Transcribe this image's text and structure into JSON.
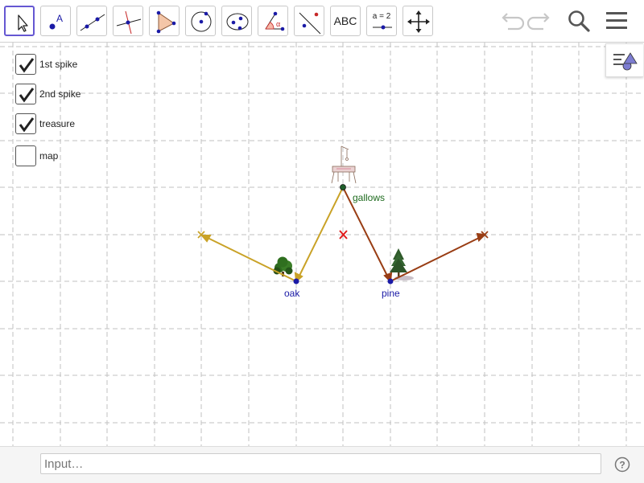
{
  "toolbar": {
    "text_tool_label": "ABC",
    "slider_tool_label": "a = 2"
  },
  "checkboxes": [
    {
      "label": "1st spike",
      "checked": true
    },
    {
      "label": "2nd spike",
      "checked": true
    },
    {
      "label": "treasure",
      "checked": true
    },
    {
      "label": "map",
      "checked": false
    }
  ],
  "points": {
    "gallows": "gallows",
    "oak": "oak",
    "pine": "pine"
  },
  "colors": {
    "accent": "#6557d2",
    "spike1": "#c9a227",
    "spike2": "#993d14",
    "treasure": "#e01b1b",
    "point": "#1a1aa6",
    "gallows_label": "#1e6b1e"
  },
  "input": {
    "placeholder": "Input…"
  }
}
